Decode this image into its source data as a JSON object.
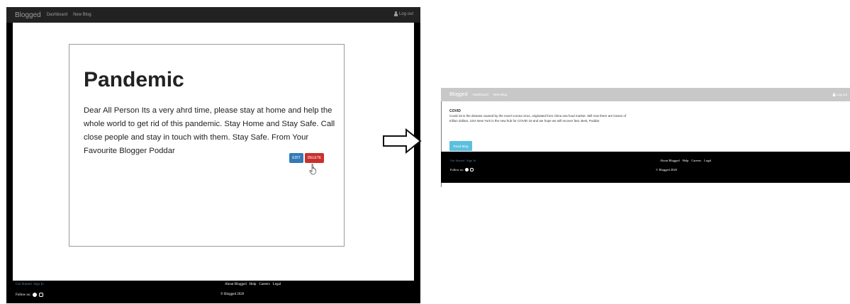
{
  "left": {
    "nav": {
      "brand": "Blogged",
      "links": [
        "Dashboard",
        "New Blog"
      ],
      "logout": "Log out"
    },
    "blog": {
      "title": "Pandemic",
      "body": "Dear All Person Its a very ahrd time, please stay at home and help the whole world to get rid of this pandemic. Stay Home and Stay Safe. Call close people and stay in touch with them. Stay Safe. From Your Favourite Blogger Poddar",
      "edit_label": "EDIT",
      "delete_label": "DELETE"
    },
    "footer": {
      "get_started": "Get Started",
      "sign_in": "Sign In",
      "links": [
        "About Blogged",
        "Help",
        "Careers",
        "Legal"
      ],
      "follow_us": "Follow us:",
      "copyright": "© Blogged 2020"
    }
  },
  "right": {
    "nav": {
      "brand": "Blogged",
      "links": [
        "Dashboard",
        "New Blog"
      ],
      "logout": "Log out"
    },
    "post": {
      "title": "COVID",
      "body": "Covid 19 is the disease caused by the novel corona virus, originated from china sea food market. Still now there are losses of trillion dollars, USA New York is the new hub for COVID 19 and we hope we will recover fast. Best, Poddar",
      "read_label": "Read Blog"
    },
    "footer": {
      "get_started": "Get Started",
      "sign_in": "Sign In",
      "links": [
        "About Blogged",
        "Help",
        "Careers",
        "Legal"
      ],
      "follow_us": "Follow us:",
      "copyright": "© Blogged 2020"
    }
  },
  "colors": {
    "navbar_dark": "#222222",
    "navbar_light": "#c8c8c8",
    "edit_button": "#337ab7",
    "delete_button": "#c9302c",
    "read_button": "#5bc0de",
    "footer": "#000000",
    "footer_link": "#5b7fa5"
  },
  "icons": [
    "user-icon",
    "hand-pointer-cursor-icon",
    "facebook-icon",
    "instagram-icon",
    "right-arrow-icon"
  ]
}
